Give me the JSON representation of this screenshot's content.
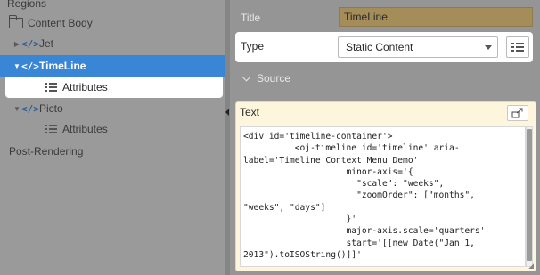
{
  "tree": {
    "regions_label": "Regions",
    "content_body_label": "Content Body",
    "jet_label": "Jet",
    "timeline_label": "TimeLine",
    "timeline_attributes_label": "Attributes",
    "picto_label": "Picto",
    "picto_attributes_label": "Attributes",
    "post_rendering_label": "Post-Rendering"
  },
  "props": {
    "title_label": "Title",
    "title_value": "TimeLine",
    "type_label": "Type",
    "type_value": "Static Content",
    "source_label": "Source",
    "text_label": "Text",
    "code": "<div id='timeline-container'>\n          <oj-timeline id='timeline' aria-\nlabel='Timeline Context Menu Demo'\n                    minor-axis='{\n                      \"scale\": \"weeks\",\n                      \"zoomOrder\": [\"months\",\n\"weeks\", \"days\"]\n                    }'\n                    major-axis.scale='quarters'\n                    start='[[new Date(\"Jan 1,\n2013\").toISOString()]]'"
  },
  "colors": {
    "selected_row": "#3a86d6",
    "title_field": "#a48d58",
    "text_panel": "#fdf6dd"
  }
}
